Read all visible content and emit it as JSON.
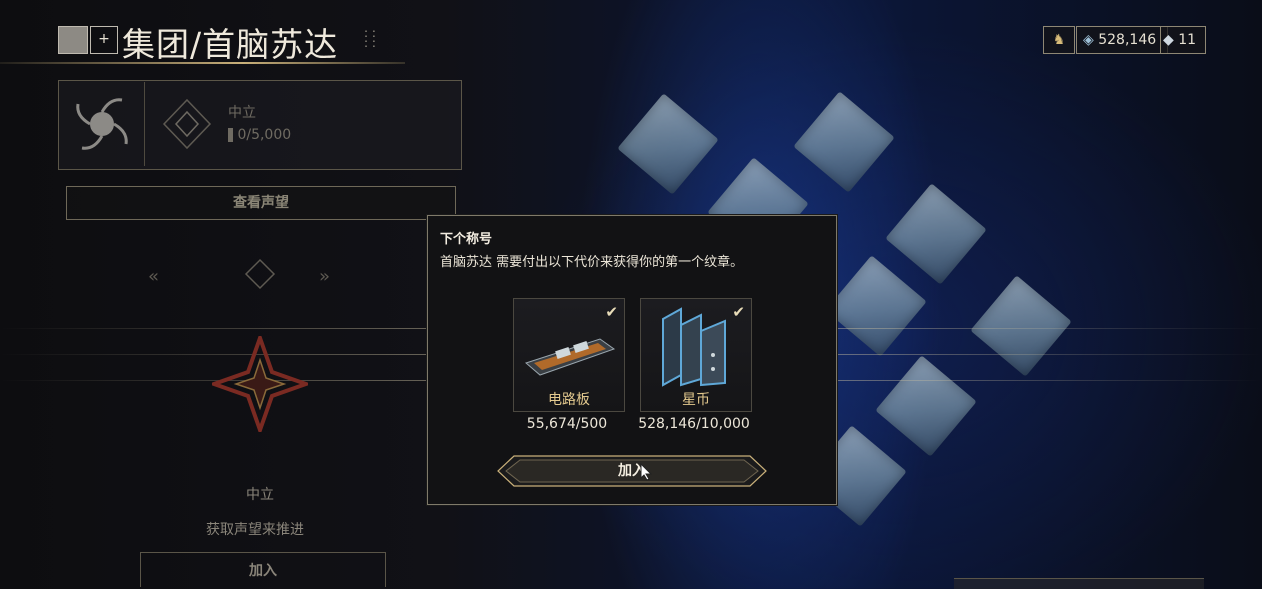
{
  "header": {
    "title": "集团/首脑苏达",
    "plus_label": "+"
  },
  "currency": {
    "credits": "528,146",
    "platinum": "11"
  },
  "faction": {
    "standing_title": "中立",
    "standing_progress": "0/5,000",
    "view_standing_label": "查看声望"
  },
  "left_panel": {
    "rank_label": "中立",
    "hint": "获取声望来推进",
    "join_label": "加入"
  },
  "modal": {
    "title": "下个称号",
    "description": "首脑苏达 需要付出以下代价来获得你的第一个纹章。",
    "items": [
      {
        "name": "电路板",
        "count": "55,674/500",
        "icon": "circuits-icon",
        "met": true
      },
      {
        "name": "星币",
        "count": "528,146/10,000",
        "icon": "credits-icon",
        "met": true
      }
    ],
    "join_label": "加入",
    "check_glyph": "✔"
  },
  "colors": {
    "accent_gold": "#c9b07a",
    "item_label": "#e3c98e",
    "background_blue": "#0b1637"
  }
}
